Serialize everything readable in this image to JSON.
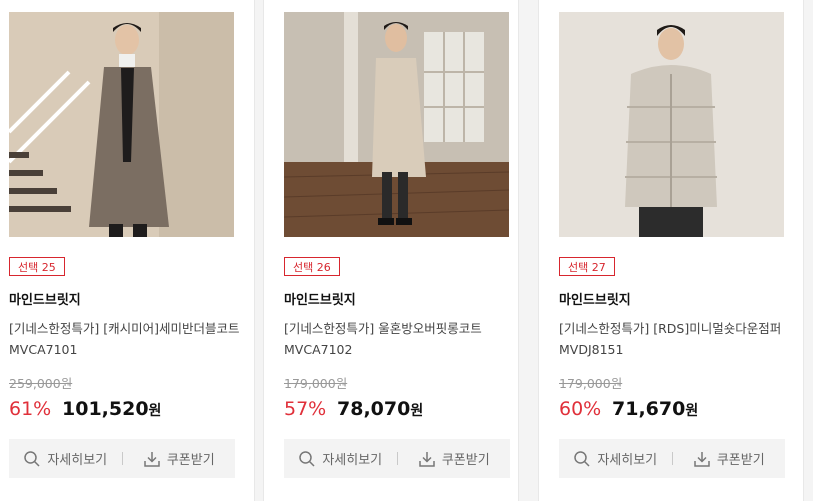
{
  "products": [
    {
      "badge": "선택 25",
      "brand": "마인드브릿지",
      "name": "[기네스한정특가] [캐시미어]세미반더블코트 MVCA7101",
      "original_price": "259,000원",
      "discount": "61%",
      "price": "101,520",
      "currency": "원",
      "detail_label": "자세히보기",
      "coupon_label": "쿠폰받기"
    },
    {
      "badge": "선택 26",
      "brand": "마인드브릿지",
      "name": "[기네스한정특가] 울혼방오버핏롱코트 MVCA7102",
      "original_price": "179,000원",
      "discount": "57%",
      "price": "78,070",
      "currency": "원",
      "detail_label": "자세히보기",
      "coupon_label": "쿠폰받기"
    },
    {
      "badge": "선택 27",
      "brand": "마인드브릿지",
      "name": "[기네스한정특가] [RDS]미니멀숏다운점퍼 MVDJ8151",
      "original_price": "179,000원",
      "discount": "60%",
      "price": "71,670",
      "currency": "원",
      "detail_label": "자세히보기",
      "coupon_label": "쿠폰받기"
    }
  ],
  "colors": {
    "accent": "#d7262e",
    "discount": "#e0303a"
  },
  "icons": {
    "detail": "search-icon",
    "coupon": "download-icon"
  }
}
